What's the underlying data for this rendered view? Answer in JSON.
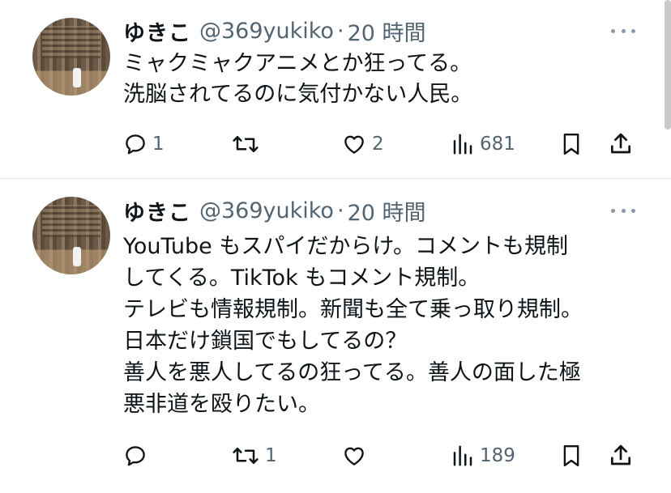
{
  "tweets": [
    {
      "display_name": "ゆきこ",
      "handle": "@369yukiko",
      "separator": "·",
      "time": "20 時間",
      "lines": [
        "ミャクミャクアニメとか狂ってる。",
        "洗脳されてるのに気付かない人民。"
      ],
      "reply_count": "1",
      "retweet_count": "",
      "like_count": "2",
      "view_count": "681"
    },
    {
      "display_name": "ゆきこ",
      "handle": "@369yukiko",
      "separator": "·",
      "time": "20 時間",
      "lines": [
        "YouTube もスパイだからけ。コメントも規制",
        "してくる。TikTok もコメント規制。",
        "テレビも情報規制。新聞も全て乗っ取り規制。",
        "日本だけ鎖国でもしてるの？",
        "善人を悪人してるの狂ってる。善人の面した極",
        "悪非道を殴りたい。"
      ],
      "reply_count": "",
      "retweet_count": "1",
      "like_count": "",
      "view_count": "189"
    }
  ],
  "icons": {
    "more": "more-horizontal-icon",
    "reply": "reply-icon",
    "retweet": "retweet-icon",
    "like": "heart-icon",
    "views": "views-chart-icon",
    "bookmark": "bookmark-icon",
    "share": "share-icon"
  },
  "colors": {
    "text": "#0f1419",
    "secondary": "#536471",
    "divider": "#e7e9ea"
  }
}
